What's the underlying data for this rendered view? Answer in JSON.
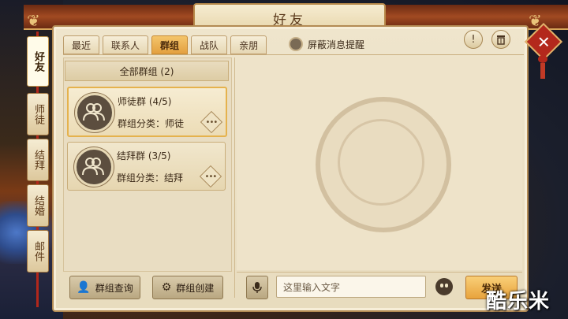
{
  "window": {
    "title": "好友"
  },
  "side_tabs": [
    "好友",
    "师徒",
    "结拜",
    "结婚",
    "邮件"
  ],
  "top_tabs": [
    "最近",
    "联系人",
    "群组",
    "战队",
    "亲朋"
  ],
  "active_tab": "群组",
  "mute": {
    "label": "屏蔽消息提醒"
  },
  "toolbar": {
    "warn_icon": "!",
    "delete_icon": "trash"
  },
  "list": {
    "header": "全部群组 (2)",
    "groups": [
      {
        "name": "师徒群 (4/5)",
        "category": "群组分类：师徒",
        "selected": true
      },
      {
        "name": "结拜群 (3/5)",
        "category": "群组分类：结拜",
        "selected": false
      }
    ]
  },
  "buttons": {
    "search": "群组查询",
    "create": "群组创建"
  },
  "chat": {
    "placeholder": "这里输入文字",
    "send": "发送"
  },
  "watermark": "酷乐米",
  "colors": {
    "accent": "#e8a33c",
    "frame": "#b38b54",
    "close": "#b3281c"
  }
}
